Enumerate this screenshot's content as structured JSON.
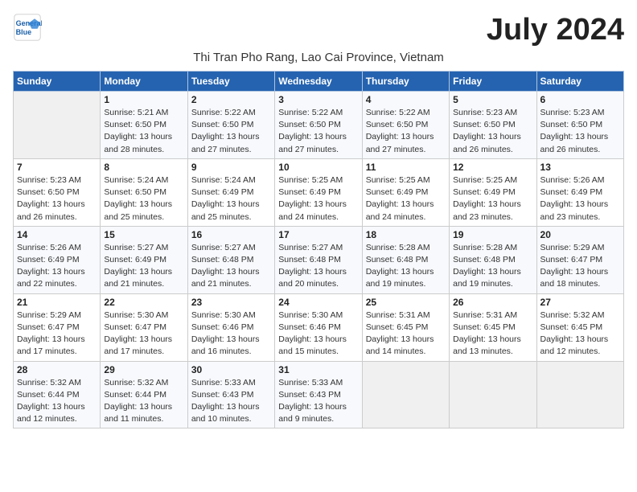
{
  "header": {
    "logo_line1": "General",
    "logo_line2": "Blue",
    "month_title": "July 2024",
    "subtitle": "Thi Tran Pho Rang, Lao Cai Province, Vietnam"
  },
  "weekdays": [
    "Sunday",
    "Monday",
    "Tuesday",
    "Wednesday",
    "Thursday",
    "Friday",
    "Saturday"
  ],
  "weeks": [
    [
      {
        "day": "",
        "info": ""
      },
      {
        "day": "1",
        "info": "Sunrise: 5:21 AM\nSunset: 6:50 PM\nDaylight: 13 hours\nand 28 minutes."
      },
      {
        "day": "2",
        "info": "Sunrise: 5:22 AM\nSunset: 6:50 PM\nDaylight: 13 hours\nand 27 minutes."
      },
      {
        "day": "3",
        "info": "Sunrise: 5:22 AM\nSunset: 6:50 PM\nDaylight: 13 hours\nand 27 minutes."
      },
      {
        "day": "4",
        "info": "Sunrise: 5:22 AM\nSunset: 6:50 PM\nDaylight: 13 hours\nand 27 minutes."
      },
      {
        "day": "5",
        "info": "Sunrise: 5:23 AM\nSunset: 6:50 PM\nDaylight: 13 hours\nand 26 minutes."
      },
      {
        "day": "6",
        "info": "Sunrise: 5:23 AM\nSunset: 6:50 PM\nDaylight: 13 hours\nand 26 minutes."
      }
    ],
    [
      {
        "day": "7",
        "info": "Sunrise: 5:23 AM\nSunset: 6:50 PM\nDaylight: 13 hours\nand 26 minutes."
      },
      {
        "day": "8",
        "info": "Sunrise: 5:24 AM\nSunset: 6:50 PM\nDaylight: 13 hours\nand 25 minutes."
      },
      {
        "day": "9",
        "info": "Sunrise: 5:24 AM\nSunset: 6:49 PM\nDaylight: 13 hours\nand 25 minutes."
      },
      {
        "day": "10",
        "info": "Sunrise: 5:25 AM\nSunset: 6:49 PM\nDaylight: 13 hours\nand 24 minutes."
      },
      {
        "day": "11",
        "info": "Sunrise: 5:25 AM\nSunset: 6:49 PM\nDaylight: 13 hours\nand 24 minutes."
      },
      {
        "day": "12",
        "info": "Sunrise: 5:25 AM\nSunset: 6:49 PM\nDaylight: 13 hours\nand 23 minutes."
      },
      {
        "day": "13",
        "info": "Sunrise: 5:26 AM\nSunset: 6:49 PM\nDaylight: 13 hours\nand 23 minutes."
      }
    ],
    [
      {
        "day": "14",
        "info": "Sunrise: 5:26 AM\nSunset: 6:49 PM\nDaylight: 13 hours\nand 22 minutes."
      },
      {
        "day": "15",
        "info": "Sunrise: 5:27 AM\nSunset: 6:49 PM\nDaylight: 13 hours\nand 21 minutes."
      },
      {
        "day": "16",
        "info": "Sunrise: 5:27 AM\nSunset: 6:48 PM\nDaylight: 13 hours\nand 21 minutes."
      },
      {
        "day": "17",
        "info": "Sunrise: 5:27 AM\nSunset: 6:48 PM\nDaylight: 13 hours\nand 20 minutes."
      },
      {
        "day": "18",
        "info": "Sunrise: 5:28 AM\nSunset: 6:48 PM\nDaylight: 13 hours\nand 19 minutes."
      },
      {
        "day": "19",
        "info": "Sunrise: 5:28 AM\nSunset: 6:48 PM\nDaylight: 13 hours\nand 19 minutes."
      },
      {
        "day": "20",
        "info": "Sunrise: 5:29 AM\nSunset: 6:47 PM\nDaylight: 13 hours\nand 18 minutes."
      }
    ],
    [
      {
        "day": "21",
        "info": "Sunrise: 5:29 AM\nSunset: 6:47 PM\nDaylight: 13 hours\nand 17 minutes."
      },
      {
        "day": "22",
        "info": "Sunrise: 5:30 AM\nSunset: 6:47 PM\nDaylight: 13 hours\nand 17 minutes."
      },
      {
        "day": "23",
        "info": "Sunrise: 5:30 AM\nSunset: 6:46 PM\nDaylight: 13 hours\nand 16 minutes."
      },
      {
        "day": "24",
        "info": "Sunrise: 5:30 AM\nSunset: 6:46 PM\nDaylight: 13 hours\nand 15 minutes."
      },
      {
        "day": "25",
        "info": "Sunrise: 5:31 AM\nSunset: 6:45 PM\nDaylight: 13 hours\nand 14 minutes."
      },
      {
        "day": "26",
        "info": "Sunrise: 5:31 AM\nSunset: 6:45 PM\nDaylight: 13 hours\nand 13 minutes."
      },
      {
        "day": "27",
        "info": "Sunrise: 5:32 AM\nSunset: 6:45 PM\nDaylight: 13 hours\nand 12 minutes."
      }
    ],
    [
      {
        "day": "28",
        "info": "Sunrise: 5:32 AM\nSunset: 6:44 PM\nDaylight: 13 hours\nand 12 minutes."
      },
      {
        "day": "29",
        "info": "Sunrise: 5:32 AM\nSunset: 6:44 PM\nDaylight: 13 hours\nand 11 minutes."
      },
      {
        "day": "30",
        "info": "Sunrise: 5:33 AM\nSunset: 6:43 PM\nDaylight: 13 hours\nand 10 minutes."
      },
      {
        "day": "31",
        "info": "Sunrise: 5:33 AM\nSunset: 6:43 PM\nDaylight: 13 hours\nand 9 minutes."
      },
      {
        "day": "",
        "info": ""
      },
      {
        "day": "",
        "info": ""
      },
      {
        "day": "",
        "info": ""
      }
    ]
  ]
}
